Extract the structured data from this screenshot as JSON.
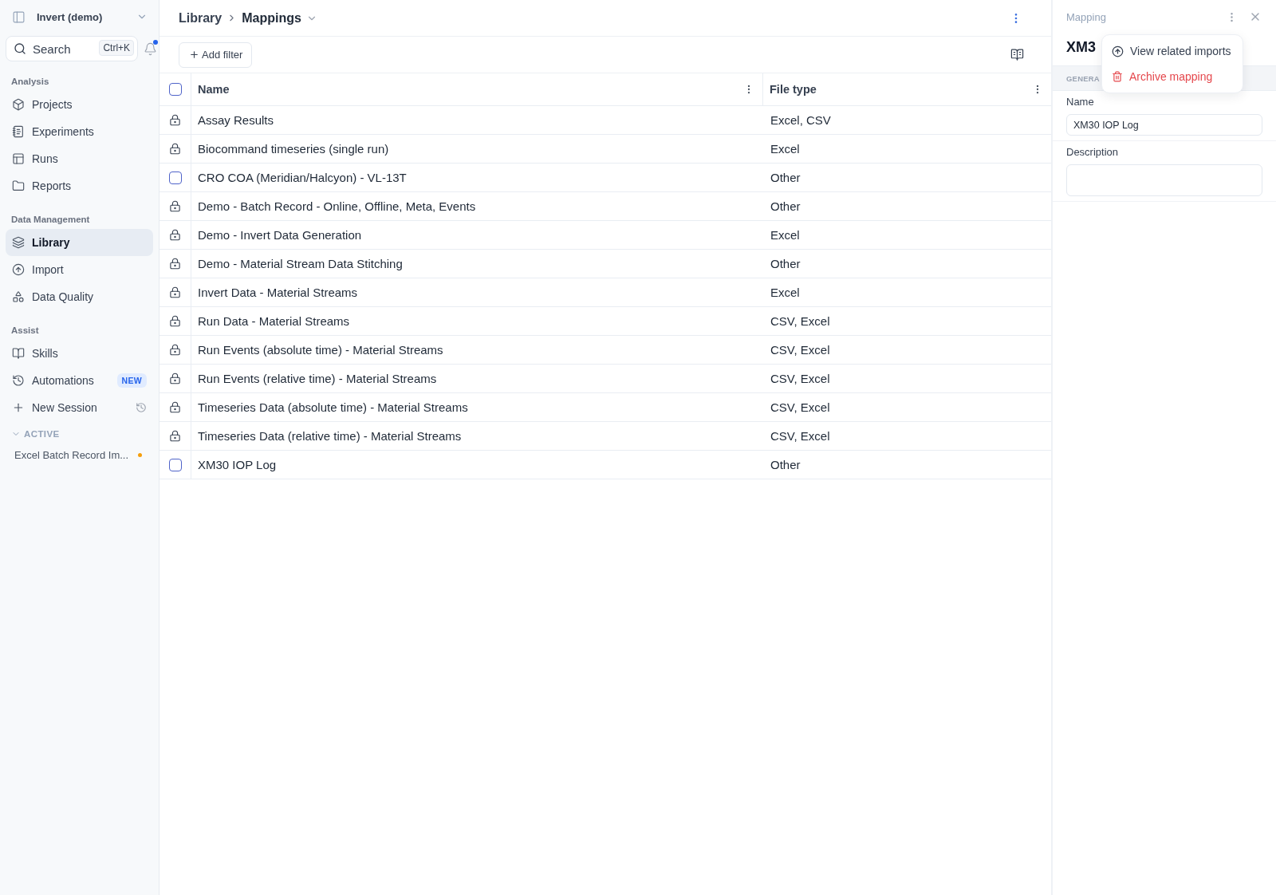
{
  "sidebar": {
    "workspace": {
      "name": "Invert (demo)"
    },
    "search": {
      "placeholder": "Search",
      "shortcut": "Ctrl+K"
    },
    "notifications": {
      "unread": true
    },
    "sections": [
      {
        "title": "Analysis",
        "items": [
          {
            "label": "Projects",
            "selected": false
          },
          {
            "label": "Experiments",
            "selected": false
          },
          {
            "label": "Runs",
            "selected": false
          },
          {
            "label": "Reports",
            "selected": false
          }
        ]
      },
      {
        "title": "Data Management",
        "items": [
          {
            "label": "Library",
            "selected": true
          },
          {
            "label": "Import",
            "selected": false
          },
          {
            "label": "Data Quality",
            "selected": false
          }
        ]
      },
      {
        "title": "Assist",
        "items": [
          {
            "label": "Skills",
            "selected": false
          },
          {
            "label": "Automations",
            "selected": false,
            "badge": "NEW"
          },
          {
            "label": "New Session",
            "selected": false
          }
        ]
      }
    ],
    "sessions": {
      "label": "ACTIVE",
      "expanded": true,
      "items": [
        {
          "title": "Excel Batch Record Im...",
          "color": "#f59e0b"
        }
      ]
    }
  },
  "header": {
    "breadcrumb": [
      "Library",
      "Mappings"
    ]
  },
  "toolbar": {
    "add_filter": "Add filter"
  },
  "table": {
    "select_all": {
      "checked": false
    },
    "columns": [
      "Name",
      "File type"
    ],
    "rows": [
      {
        "kind": "locked",
        "name": "Assay Results",
        "file_type": "Excel, CSV"
      },
      {
        "kind": "locked",
        "name": "Biocommand timeseries (single run)",
        "file_type": "Excel"
      },
      {
        "kind": "checkbox",
        "checked": false,
        "name": "CRO COA (Meridian/Halcyon) - VL-13T",
        "file_type": "Other"
      },
      {
        "kind": "locked",
        "name": "Demo - Batch Record - Online, Offline, Meta, Events",
        "file_type": "Other"
      },
      {
        "kind": "locked",
        "name": "Demo - Invert Data Generation",
        "file_type": "Excel"
      },
      {
        "kind": "locked",
        "name": "Demo - Material Stream Data Stitching",
        "file_type": "Other"
      },
      {
        "kind": "locked",
        "name": "Invert Data - Material Streams",
        "file_type": "Excel"
      },
      {
        "kind": "locked",
        "name": "Run Data - Material Streams",
        "file_type": "CSV, Excel"
      },
      {
        "kind": "locked",
        "name": "Run Events (absolute time) - Material Streams",
        "file_type": "CSV, Excel"
      },
      {
        "kind": "locked",
        "name": "Run Events (relative time) - Material Streams",
        "file_type": "CSV, Excel"
      },
      {
        "kind": "locked",
        "name": "Timeseries Data (absolute time) - Material Streams",
        "file_type": "CSV, Excel"
      },
      {
        "kind": "locked",
        "name": "Timeseries Data (relative time) - Material Streams",
        "file_type": "CSV, Excel"
      },
      {
        "kind": "checkbox",
        "checked": false,
        "name": "XM30 IOP Log",
        "file_type": "Other"
      }
    ]
  },
  "panel": {
    "label": "Mapping",
    "title": "XM3",
    "section": "GENERA",
    "fields": [
      {
        "kind": "input",
        "label": "Name",
        "value": "XM30 IOP Log"
      },
      {
        "kind": "textarea",
        "label": "Description"
      }
    ]
  },
  "menu": {
    "items": [
      {
        "kind": "normal",
        "label": "View related imports"
      },
      {
        "kind": "danger",
        "label": "Archive mapping"
      }
    ]
  }
}
